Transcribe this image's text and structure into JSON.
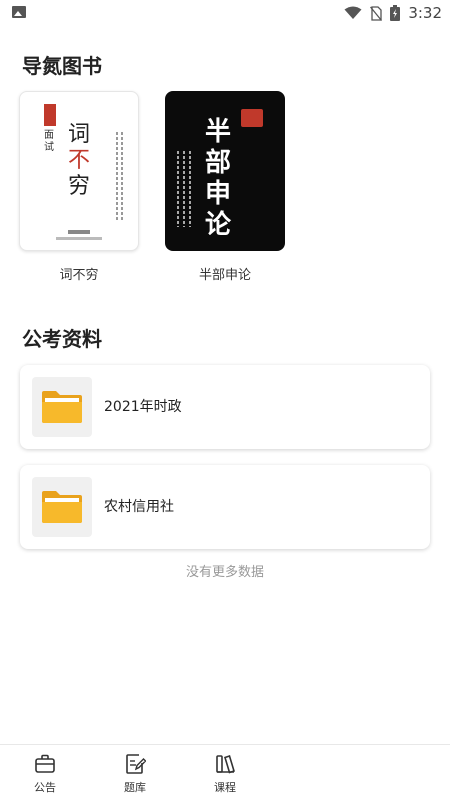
{
  "status_bar": {
    "time": "3:32",
    "icons": [
      "image-icon",
      "wifi-icon",
      "no-sim-icon",
      "battery-charging-icon"
    ]
  },
  "books_section": {
    "title": "导氮图书",
    "items": [
      {
        "name": "词不穷",
        "cover": {
          "big_chars": [
            "词",
            "不",
            "穷"
          ],
          "sub": "面试"
        }
      },
      {
        "name": "半部申论",
        "cover": {
          "big_chars": [
            "半",
            "部",
            "申",
            "论"
          ]
        }
      }
    ]
  },
  "materials_section": {
    "title": "公考资料",
    "items": [
      {
        "label": "2021年时政",
        "icon": "folder-icon"
      },
      {
        "label": "农村信用社",
        "icon": "folder-icon"
      }
    ]
  },
  "list_footer": "没有更多数据",
  "tabbar": {
    "tabs": [
      {
        "label": "公告",
        "icon": "briefcase-icon"
      },
      {
        "label": "题库",
        "icon": "edit-document-icon"
      },
      {
        "label": "课程",
        "icon": "books-icon"
      }
    ]
  },
  "colors": {
    "accent_red": "#c0392b",
    "folder_yellow": "#f7b92b",
    "card_bg": "#ffffff",
    "muted_text": "#999999"
  }
}
